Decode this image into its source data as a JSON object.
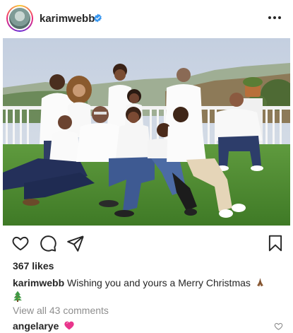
{
  "post": {
    "username": "karimwebb",
    "verified": true,
    "avatar_icon": "avatar-photo",
    "more_icon": "more-horizontal-icon"
  },
  "actions": {
    "like_icon": "heart-outline-icon",
    "comment_icon": "comment-bubble-icon",
    "share_icon": "paper-plane-icon",
    "save_icon": "bookmark-icon"
  },
  "likes": "367 likes",
  "caption": {
    "username": "karimwebb",
    "text": "Wishing you and yours a Merry Christmas",
    "emoji_1": "folded-hands-emoji",
    "emoji_2": "christmas-tree-emoji"
  },
  "comments_link": "View all 43 comments",
  "comment": {
    "username": "angelarye",
    "emoji": "pink-heart-emoji",
    "like_icon": "small-heart-outline-icon"
  },
  "colors": {
    "text": "#262626",
    "muted": "#8e8e8e",
    "verified_blue": "#3897f0",
    "heart_pink": "#e9358c"
  }
}
